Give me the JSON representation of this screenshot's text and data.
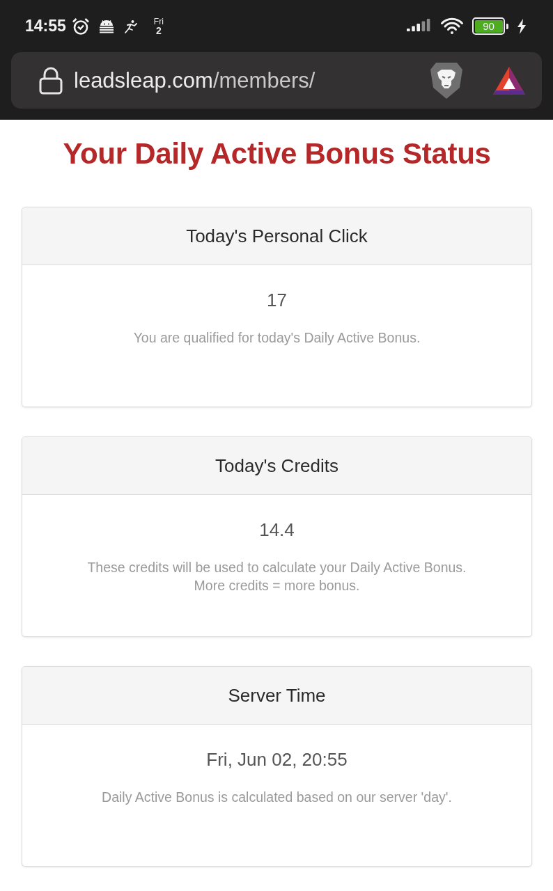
{
  "status_bar": {
    "time": "14:55",
    "date": {
      "weekday": "Fri",
      "day": "2"
    },
    "battery": {
      "reading": "90",
      "charging": true
    }
  },
  "address_bar": {
    "domain": "leadsleap.com",
    "path": "/members/"
  },
  "page": {
    "title": "Your Daily Active Bonus Status"
  },
  "cards": [
    {
      "header": "Today's Personal Click",
      "value": "17",
      "notes": [
        "You are qualified for today's Daily Active Bonus."
      ]
    },
    {
      "header": "Today's Credits",
      "value": "14.4",
      "notes": [
        "These credits will be used to calculate your Daily Active Bonus.",
        "More credits = more bonus."
      ]
    },
    {
      "header": "Server Time",
      "value": "Fri, Jun 02, 20:55",
      "notes": [
        "Daily Active Bonus is calculated based on our server 'day'."
      ]
    }
  ]
}
